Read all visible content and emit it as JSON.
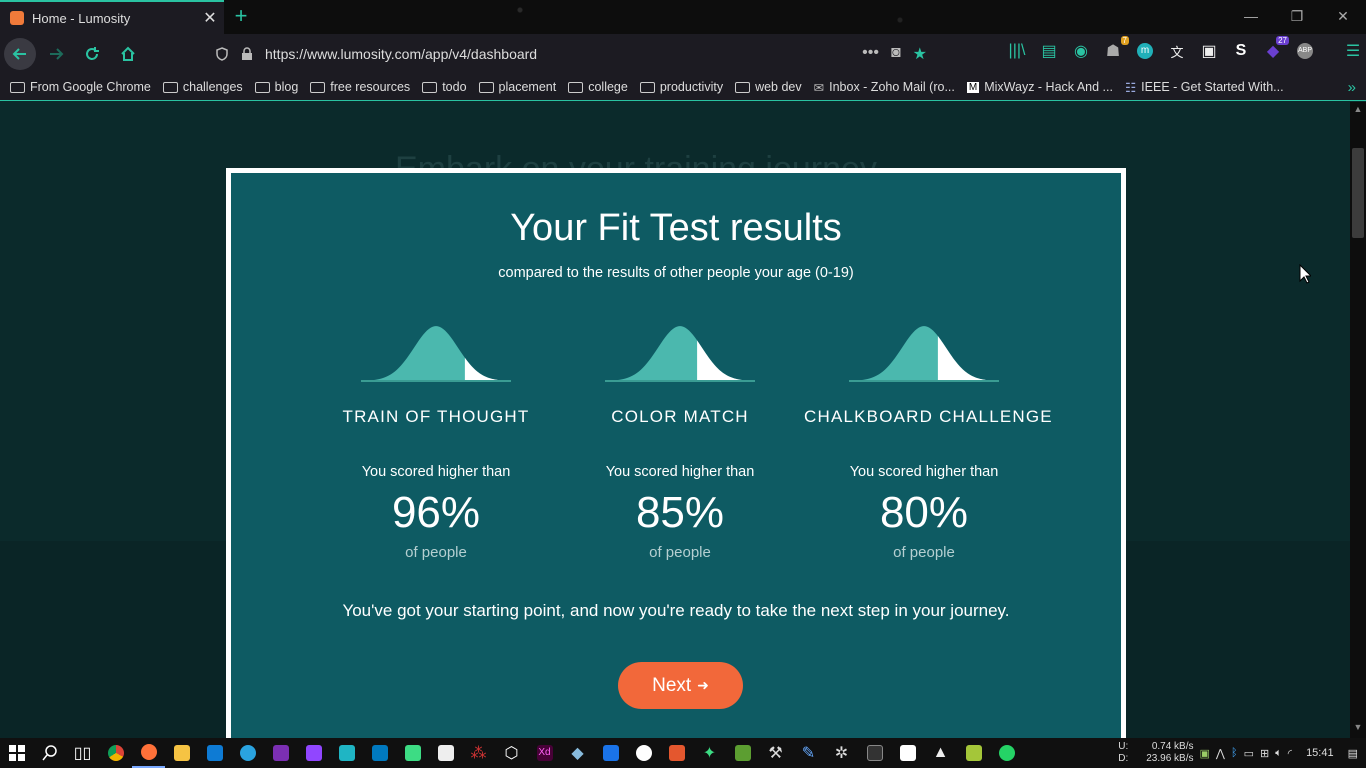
{
  "browser": {
    "tab_title": "Home - Lumosity",
    "url": "https://www.lumosity.com/app/v4/dashboard",
    "extension_badges": {
      "ghost": "7",
      "purple": "27"
    },
    "bookmarks": [
      {
        "label": "From Google Chrome",
        "type": "folder"
      },
      {
        "label": "challenges",
        "type": "folder"
      },
      {
        "label": "blog",
        "type": "folder"
      },
      {
        "label": "free resources",
        "type": "folder"
      },
      {
        "label": "todo",
        "type": "folder"
      },
      {
        "label": "placement",
        "type": "folder"
      },
      {
        "label": "college",
        "type": "folder"
      },
      {
        "label": "productivity",
        "type": "folder"
      },
      {
        "label": "web dev",
        "type": "folder"
      },
      {
        "label": "Inbox - Zoho Mail (ro...",
        "type": "link"
      },
      {
        "label": "MixWayz - Hack And ...",
        "type": "link"
      },
      {
        "label": "IEEE - Get Started With...",
        "type": "link"
      }
    ]
  },
  "page": {
    "background_heading": "Embark on your training journey",
    "modal": {
      "title": "Your Fit Test results",
      "subtitle": "compared to the results of other people your age (0-19)",
      "results": [
        {
          "game": "TRAIN OF THOUGHT",
          "prefix": "You scored higher than",
          "percent": "96%",
          "suffix": "of people",
          "percentile": 96
        },
        {
          "game": "COLOR MATCH",
          "prefix": "You scored higher than",
          "percent": "85%",
          "suffix": "of people",
          "percentile": 85
        },
        {
          "game": "CHALKBOARD CHALLENGE",
          "prefix": "You scored higher than",
          "percent": "80%",
          "suffix": "of people",
          "percentile": 80
        }
      ],
      "closing_text": "You've got your starting point, and now you're ready to take the next step in your journey.",
      "next_button": "Next",
      "next_arrow": "➜"
    }
  },
  "taskbar": {
    "upload_label": "U:",
    "download_label": "D:",
    "upload_speed": "0.74 kB/s",
    "download_speed": "23.96 kB/s",
    "time": "15:41"
  },
  "colors": {
    "modal_bg": "#0e5b63",
    "curve_fill": "#4bb8ae",
    "next_button": "#f2683a",
    "accent": "#2ac3a2"
  }
}
